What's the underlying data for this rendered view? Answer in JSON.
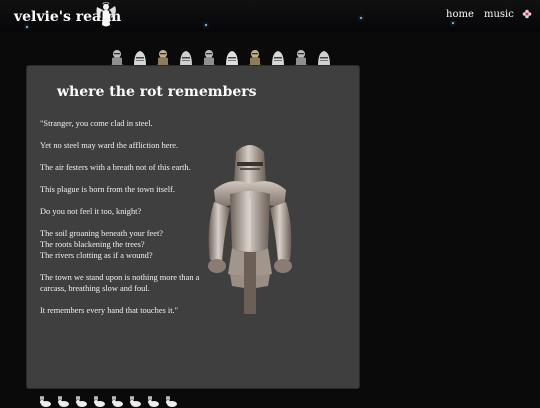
{
  "header": {
    "site_title": "velvie's realm",
    "nav": [
      {
        "label": "home"
      },
      {
        "label": "music"
      }
    ],
    "logo_icon": "angel-icon",
    "corner_icon": "flower-icon"
  },
  "decor": {
    "top_row_icon": "knight-figure-icon",
    "top_row_count": 10,
    "bottom_row_icon": "bunny-icon",
    "bottom_row_count": 8
  },
  "content": {
    "title": "where the rot remembers",
    "image_icon": "suit-of-armor-image",
    "paragraphs": [
      "\"Stranger, you come clad in steel.",
      "Yet no steel may ward the affliction here.",
      "The air festers with a breath not of this earth.",
      "This plague is born from the town itself.",
      "Do you not feel it too, knight?",
      "The soil groaning beneath your feet?\nThe roots blackening the trees?\nThe rivers clotting as if a wound?",
      "The town we stand upon is nothing more than a carcass, breathing slow and foul.",
      "It remembers every hand that touches it.\""
    ]
  },
  "colors": {
    "page_bg": "#0a0a0a",
    "panel_bg": "#3f3f3f",
    "text": "#f2f2f2",
    "star": "#8fd0ff"
  }
}
